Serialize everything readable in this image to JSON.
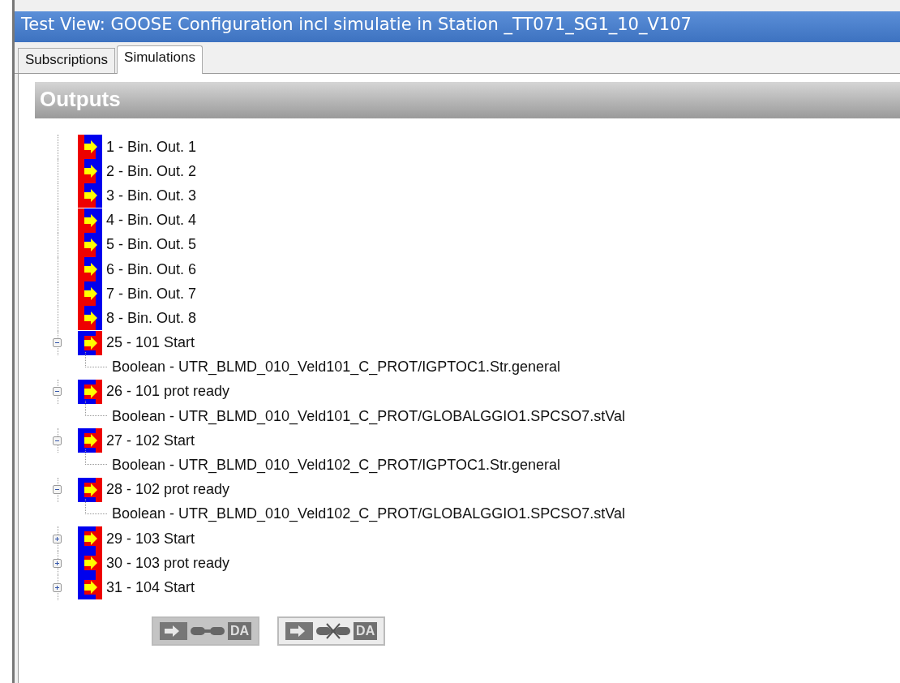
{
  "window": {
    "title": "Test View: GOOSE Configuration incl simulatie in Station _TT071_SG1_10_V107"
  },
  "tabs": [
    {
      "label": "Subscriptions",
      "selected": false
    },
    {
      "label": "Simulations",
      "selected": true
    }
  ],
  "section": {
    "title": "Outputs"
  },
  "tree": [
    {
      "label": "1 - Bin. Out. 1",
      "kind": "binary"
    },
    {
      "label": "2 - Bin. Out. 2",
      "kind": "binary"
    },
    {
      "label": "3 - Bin. Out. 3",
      "kind": "binary"
    },
    {
      "label": "4 - Bin. Out. 4",
      "kind": "binary"
    },
    {
      "label": "5 - Bin. Out. 5",
      "kind": "binary"
    },
    {
      "label": "6 - Bin. Out. 6",
      "kind": "binary"
    },
    {
      "label": "7 - Bin. Out. 7",
      "kind": "binary"
    },
    {
      "label": "8 - Bin. Out. 8",
      "kind": "binary"
    },
    {
      "label": "25 - 101 Start",
      "kind": "goose",
      "expanded": true,
      "children": [
        {
          "label": "Boolean - UTR_BLMD_010_Veld101_C_PROT/IGPTOC1.Str.general"
        }
      ]
    },
    {
      "label": "26 - 101 prot ready",
      "kind": "goose",
      "expanded": true,
      "children": [
        {
          "label": "Boolean - UTR_BLMD_010_Veld101_C_PROT/GLOBALGGIO1.SPCSO7.stVal"
        }
      ]
    },
    {
      "label": "27 - 102 Start",
      "kind": "goose",
      "expanded": true,
      "children": [
        {
          "label": "Boolean - UTR_BLMD_010_Veld102_C_PROT/IGPTOC1.Str.general"
        }
      ]
    },
    {
      "label": "28 - 102 prot ready",
      "kind": "goose",
      "expanded": true,
      "children": [
        {
          "label": "Boolean - UTR_BLMD_010_Veld102_C_PROT/GLOBALGGIO1.SPCSO7.stVal"
        }
      ]
    },
    {
      "label": "29 - 103 Start",
      "kind": "goose",
      "expanded": false
    },
    {
      "label": "30 - 103 prot ready",
      "kind": "goose",
      "expanded": false
    },
    {
      "label": "31 - 104 Start",
      "kind": "goose",
      "expanded": false
    }
  ],
  "buttons": [
    {
      "label": "DA",
      "kind": "link"
    },
    {
      "label": "DA",
      "kind": "unlink"
    }
  ]
}
